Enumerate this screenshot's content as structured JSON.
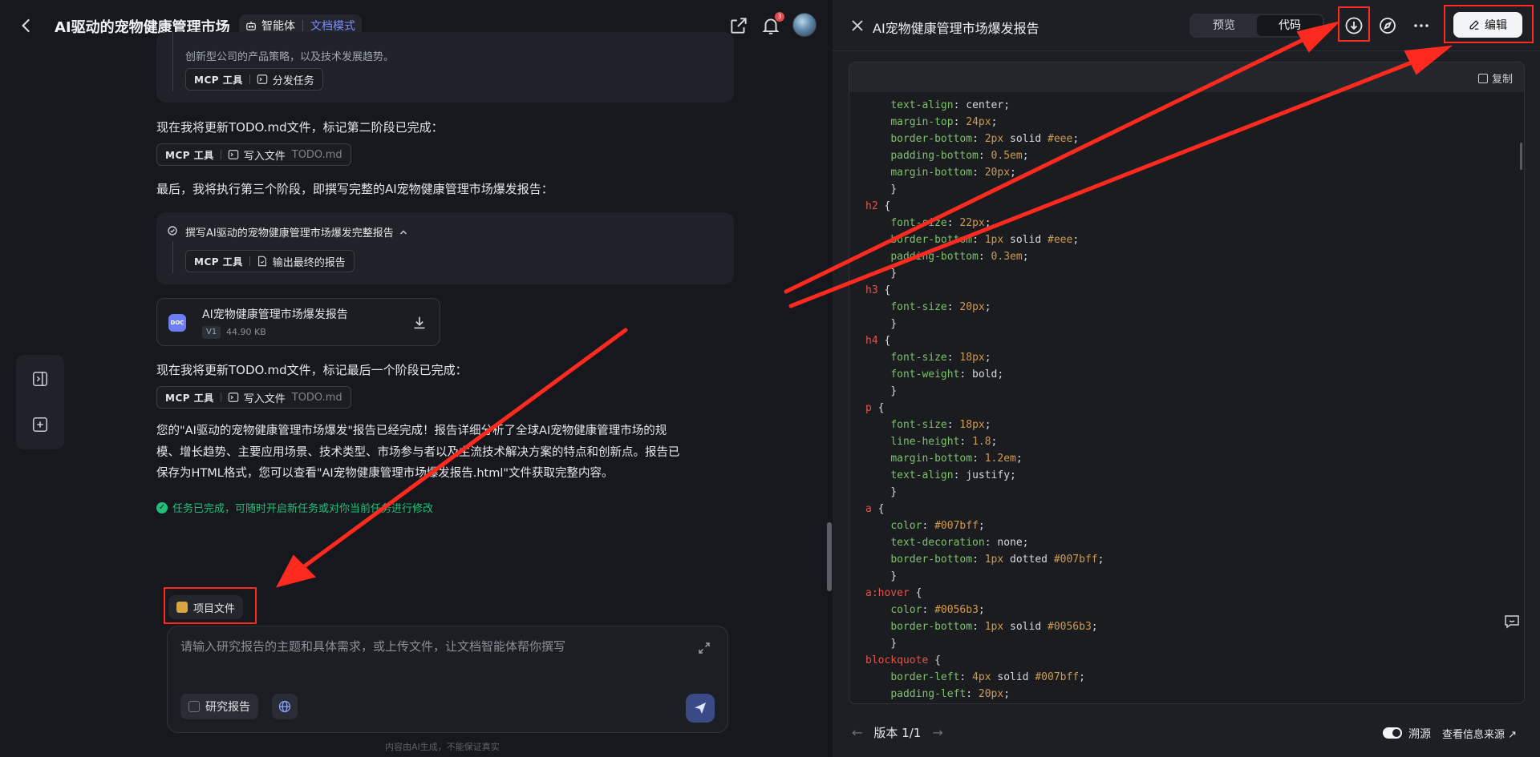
{
  "topbar": {
    "title": "AI驱动的宠物健康管理市场",
    "agent_label": "智能体",
    "mode_label": "文档模式",
    "notification_count": "3"
  },
  "chat": {
    "prev_card_text": "创新型公司的产品策略，以及技术发展趋势。",
    "prev_card_tag": {
      "tool": "MCP 工具",
      "action": "分发任务"
    },
    "msg1": "现在我将更新TODO.md文件，标记第二阶段已完成：",
    "tag1": {
      "tool": "MCP 工具",
      "action": "写入文件",
      "file": "TODO.md"
    },
    "msg2": "最后，我将执行第三个阶段，即撰写完整的AI宠物健康管理市场爆发报告：",
    "task_title": "撰写AI驱动的宠物健康管理市场爆发完整报告",
    "task_tag": {
      "tool": "MCP 工具",
      "action": "输出最终的报告"
    },
    "doc": {
      "icon_text": "DOC",
      "name": "AI宠物健康管理市场爆发报告",
      "version": "V1",
      "size": "44.90 KB"
    },
    "msg3": "现在我将更新TODO.md文件，标记最后一个阶段已完成：",
    "tag3": {
      "tool": "MCP 工具",
      "action": "写入文件",
      "file": "TODO.md"
    },
    "summary_line1": "您的\"AI驱动的宠物健康管理市场爆发\"报告已经完成！报告详细分析了全球AI宠物健康管理市场的规",
    "summary_line2": "模、增长趋势、主要应用场景、技术类型、市场参与者以及主流技术解决方案的特点和创新点。报告已",
    "summary_line3": "保存为HTML格式，您可以查看\"AI宠物健康管理市场爆发报告.html\"文件获取完整内容。",
    "done_text": "任务已完成，可随时开启新任务或对你当前任务进行修改"
  },
  "composer": {
    "project_files_label": "项目文件",
    "placeholder": "请输入研究报告的主题和具体需求，或上传文件，让文档智能体帮你撰写",
    "research_label": "研究报告",
    "disclaimer": "内容由AI生成，不能保证真实"
  },
  "panel": {
    "title": "AI宠物健康管理市场爆发报告",
    "tabs": [
      "预览",
      "代码"
    ],
    "active_tab": "代码",
    "edit_label": "编辑",
    "copy_label": "复制",
    "version_label": "版本 1/1",
    "trace_label": "溯源",
    "source_label": "查看信息来源"
  },
  "code_lines": [
    [
      [
        "    ",
        "p"
      ],
      [
        "text-align",
        "prop"
      ],
      [
        ": center;",
        "p"
      ]
    ],
    [
      [
        "    ",
        "p"
      ],
      [
        "margin-top",
        "prop"
      ],
      [
        ": ",
        "p"
      ],
      [
        "24px",
        "num"
      ],
      [
        ";",
        "p"
      ]
    ],
    [
      [
        "    ",
        "p"
      ],
      [
        "border-bottom",
        "prop"
      ],
      [
        ": ",
        "p"
      ],
      [
        "2px",
        "num"
      ],
      [
        " solid ",
        "p"
      ],
      [
        "#eee",
        "num"
      ],
      [
        ";",
        "p"
      ]
    ],
    [
      [
        "    ",
        "p"
      ],
      [
        "padding-bottom",
        "prop"
      ],
      [
        ": ",
        "p"
      ],
      [
        "0.5em",
        "num"
      ],
      [
        ";",
        "p"
      ]
    ],
    [
      [
        "    ",
        "p"
      ],
      [
        "margin-bottom",
        "prop"
      ],
      [
        ": ",
        "p"
      ],
      [
        "20px",
        "num"
      ],
      [
        ";",
        "p"
      ]
    ],
    [
      [
        "    }",
        "p"
      ]
    ],
    [
      [
        "h2",
        "sel"
      ],
      [
        " {",
        "p"
      ]
    ],
    [
      [
        "    ",
        "p"
      ],
      [
        "font-size",
        "prop"
      ],
      [
        ": ",
        "p"
      ],
      [
        "22px",
        "num"
      ],
      [
        ";",
        "p"
      ]
    ],
    [
      [
        "    ",
        "p"
      ],
      [
        "border-bottom",
        "prop"
      ],
      [
        ": ",
        "p"
      ],
      [
        "1px",
        "num"
      ],
      [
        " solid ",
        "p"
      ],
      [
        "#eee",
        "num"
      ],
      [
        ";",
        "p"
      ]
    ],
    [
      [
        "    ",
        "p"
      ],
      [
        "padding-bottom",
        "prop"
      ],
      [
        ": ",
        "p"
      ],
      [
        "0.3em",
        "num"
      ],
      [
        ";",
        "p"
      ]
    ],
    [
      [
        "    }",
        "p"
      ]
    ],
    [
      [
        "h3",
        "sel"
      ],
      [
        " {",
        "p"
      ]
    ],
    [
      [
        "    ",
        "p"
      ],
      [
        "font-size",
        "prop"
      ],
      [
        ": ",
        "p"
      ],
      [
        "20px",
        "num"
      ],
      [
        ";",
        "p"
      ]
    ],
    [
      [
        "    }",
        "p"
      ]
    ],
    [
      [
        "h4",
        "sel"
      ],
      [
        " {",
        "p"
      ]
    ],
    [
      [
        "    ",
        "p"
      ],
      [
        "font-size",
        "prop"
      ],
      [
        ": ",
        "p"
      ],
      [
        "18px",
        "num"
      ],
      [
        ";",
        "p"
      ]
    ],
    [
      [
        "    ",
        "p"
      ],
      [
        "font-weight",
        "prop"
      ],
      [
        ": bold;",
        "p"
      ]
    ],
    [
      [
        "    }",
        "p"
      ]
    ],
    [
      [
        "p",
        "sel"
      ],
      [
        " {",
        "p"
      ]
    ],
    [
      [
        "    ",
        "p"
      ],
      [
        "font-size",
        "prop"
      ],
      [
        ": ",
        "p"
      ],
      [
        "18px",
        "num"
      ],
      [
        ";",
        "p"
      ]
    ],
    [
      [
        "    ",
        "p"
      ],
      [
        "line-height",
        "prop"
      ],
      [
        ": ",
        "p"
      ],
      [
        "1.8",
        "num"
      ],
      [
        ";",
        "p"
      ]
    ],
    [
      [
        "    ",
        "p"
      ],
      [
        "margin-bottom",
        "prop"
      ],
      [
        ": ",
        "p"
      ],
      [
        "1.2em",
        "num"
      ],
      [
        ";",
        "p"
      ]
    ],
    [
      [
        "    ",
        "p"
      ],
      [
        "text-align",
        "prop"
      ],
      [
        ": justify;",
        "p"
      ]
    ],
    [
      [
        "    }",
        "p"
      ]
    ],
    [
      [
        "a",
        "sel"
      ],
      [
        " {",
        "p"
      ]
    ],
    [
      [
        "    ",
        "p"
      ],
      [
        "color",
        "prop"
      ],
      [
        ": ",
        "p"
      ],
      [
        "#007bff",
        "num"
      ],
      [
        ";",
        "p"
      ]
    ],
    [
      [
        "    ",
        "p"
      ],
      [
        "text-decoration",
        "prop"
      ],
      [
        ": none;",
        "p"
      ]
    ],
    [
      [
        "    ",
        "p"
      ],
      [
        "border-bottom",
        "prop"
      ],
      [
        ": ",
        "p"
      ],
      [
        "1px",
        "num"
      ],
      [
        " dotted ",
        "p"
      ],
      [
        "#007bff",
        "num"
      ],
      [
        ";",
        "p"
      ]
    ],
    [
      [
        "    }",
        "p"
      ]
    ],
    [
      [
        "a:hover",
        "sel"
      ],
      [
        " {",
        "p"
      ]
    ],
    [
      [
        "    ",
        "p"
      ],
      [
        "color",
        "prop"
      ],
      [
        ": ",
        "p"
      ],
      [
        "#0056b3",
        "num"
      ],
      [
        ";",
        "p"
      ]
    ],
    [
      [
        "    ",
        "p"
      ],
      [
        "border-bottom",
        "prop"
      ],
      [
        ": ",
        "p"
      ],
      [
        "1px",
        "num"
      ],
      [
        " solid ",
        "p"
      ],
      [
        "#0056b3",
        "num"
      ],
      [
        ";",
        "p"
      ]
    ],
    [
      [
        "    }",
        "p"
      ]
    ],
    [
      [
        "blockquote",
        "sel"
      ],
      [
        " {",
        "p"
      ]
    ],
    [
      [
        "    ",
        "p"
      ],
      [
        "border-left",
        "prop"
      ],
      [
        ": ",
        "p"
      ],
      [
        "4px",
        "num"
      ],
      [
        " solid ",
        "p"
      ],
      [
        "#007bff",
        "num"
      ],
      [
        ";",
        "p"
      ]
    ],
    [
      [
        "    ",
        "p"
      ],
      [
        "padding-left",
        "prop"
      ],
      [
        ": ",
        "p"
      ],
      [
        "20px",
        "num"
      ],
      [
        ";",
        "p"
      ]
    ]
  ],
  "colors": {
    "accent": "#7a8cff",
    "success": "#20c07c",
    "annotation_red": "#ff2a1f"
  }
}
